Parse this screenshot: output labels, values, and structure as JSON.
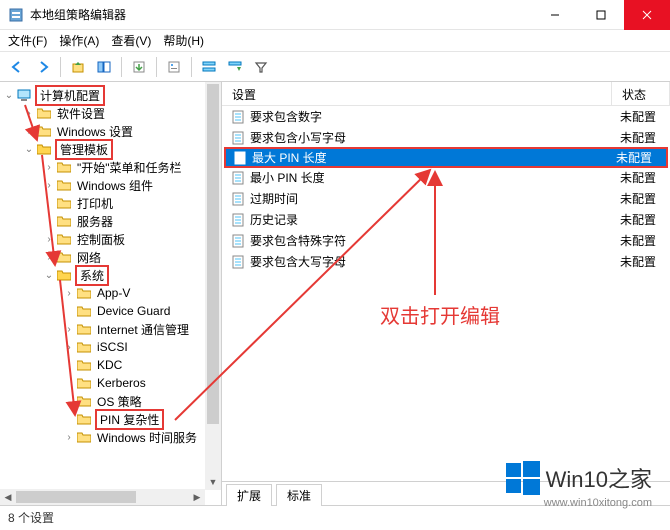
{
  "window": {
    "title": "本地组策略编辑器"
  },
  "menu": {
    "file": "文件(F)",
    "action": "操作(A)",
    "view": "查看(V)",
    "help": "帮助(H)"
  },
  "tree": {
    "root": "计算机配置",
    "n_software": "软件设置",
    "n_windows": "Windows 设置",
    "n_admin": "管理模板",
    "n_start": "\"开始\"菜单和任务栏",
    "n_wincomp": "Windows 组件",
    "n_printer": "打印机",
    "n_server": "服务器",
    "n_control": "控制面板",
    "n_network": "网络",
    "n_system": "系统",
    "n_appv": "App-V",
    "n_devguard": "Device Guard",
    "n_inet": "Internet 通信管理",
    "n_iscsi": "iSCSI",
    "n_kdc": "KDC",
    "n_kerb": "Kerberos",
    "n_os": "OS 策略",
    "n_pin": "PIN 复杂性",
    "n_time": "Windows 时间服务"
  },
  "list": {
    "col_setting": "设置",
    "col_state": "状态",
    "rows": [
      {
        "label": "要求包含数字",
        "state": "未配置"
      },
      {
        "label": "要求包含小写字母",
        "state": "未配置"
      },
      {
        "label": "最大 PIN 长度",
        "state": "未配置"
      },
      {
        "label": "最小 PIN 长度",
        "state": "未配置"
      },
      {
        "label": "过期时间",
        "state": "未配置"
      },
      {
        "label": "历史记录",
        "state": "未配置"
      },
      {
        "label": "要求包含特殊字符",
        "state": "未配置"
      },
      {
        "label": "要求包含大写字母",
        "state": "未配置"
      }
    ]
  },
  "tabs": {
    "extended": "扩展",
    "standard": "标准"
  },
  "statusbar": "8 个设置",
  "annotation": "双击打开编辑",
  "watermark": {
    "text": "Win10之家",
    "url": "www.win10xitong.com"
  }
}
